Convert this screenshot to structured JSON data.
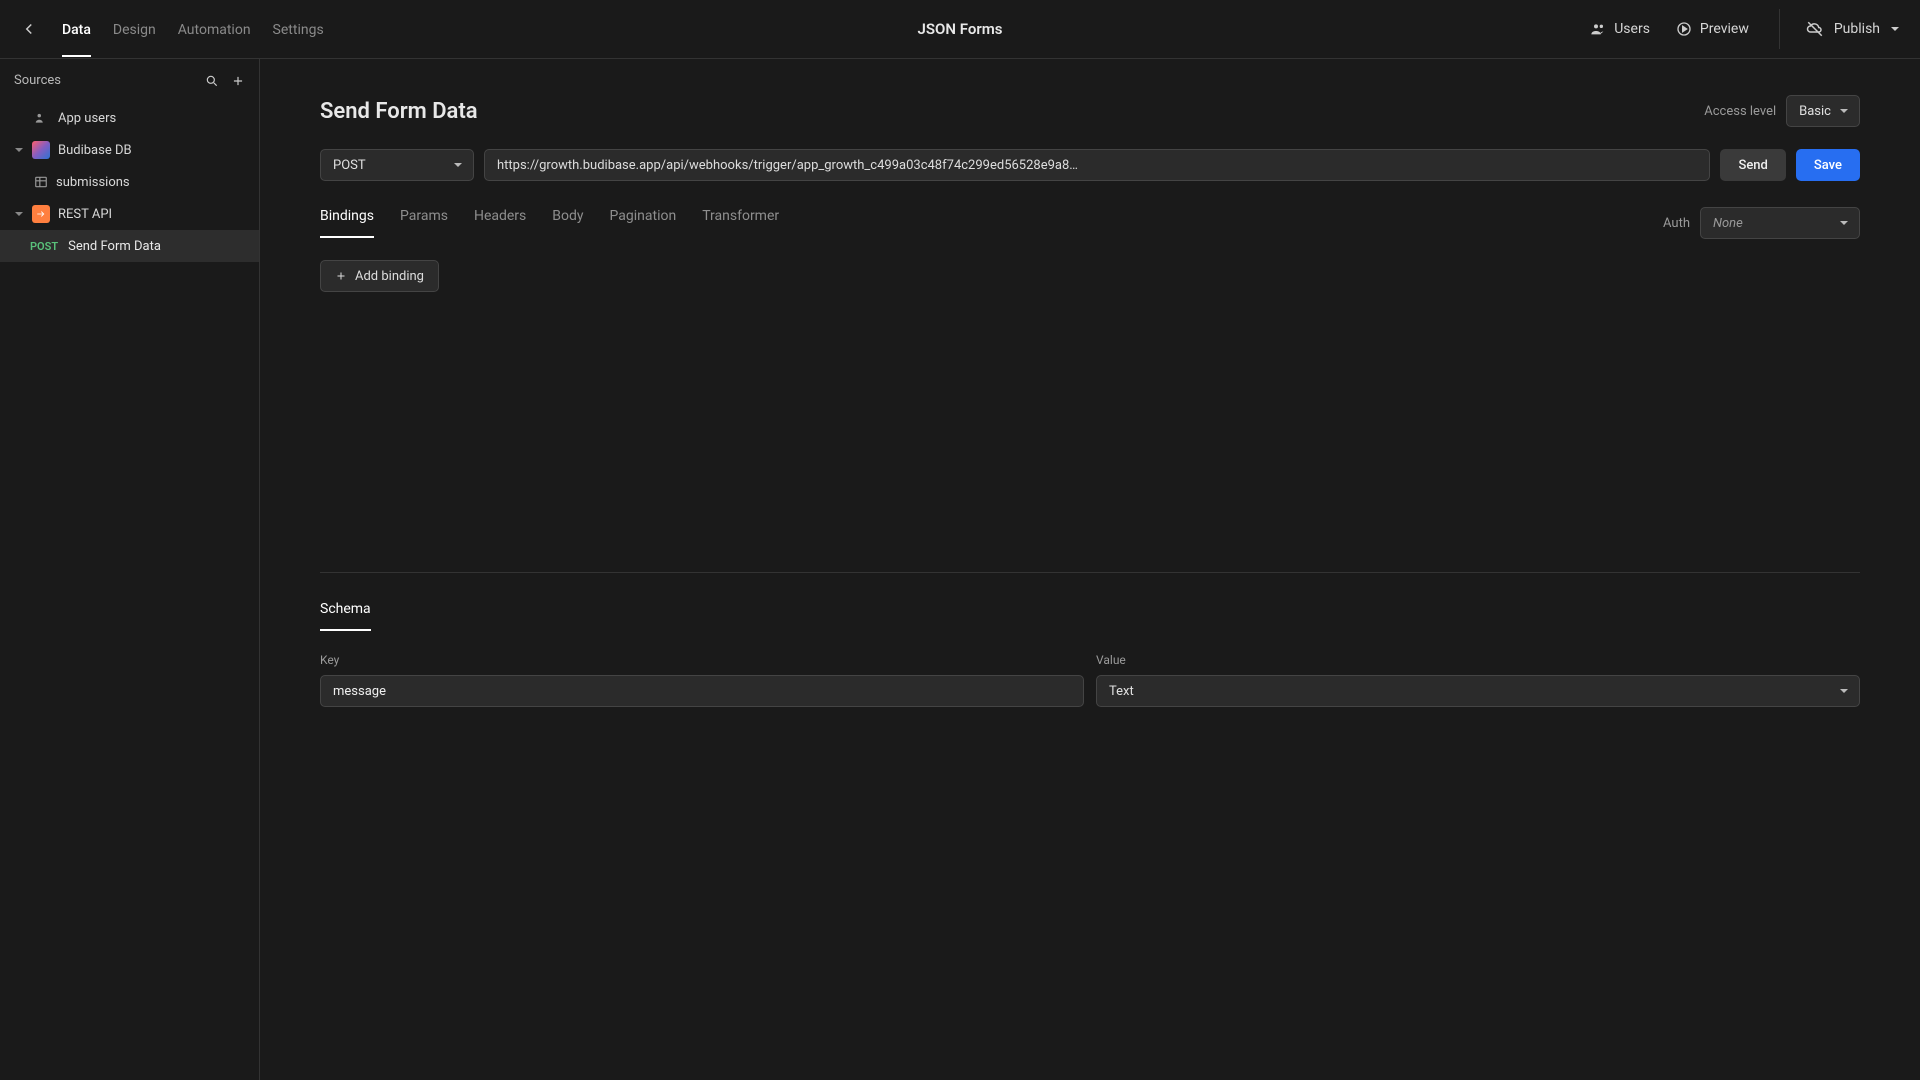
{
  "header": {
    "app_title": "JSON Forms",
    "tabs": {
      "data": "Data",
      "design": "Design",
      "automation": "Automation",
      "settings": "Settings"
    },
    "right": {
      "users": "Users",
      "preview": "Preview",
      "publish": "Publish"
    }
  },
  "sidebar": {
    "title": "Sources",
    "items": {
      "app_users": "App users",
      "budibase_db": "Budibase DB",
      "submissions": "submissions",
      "rest": "REST API",
      "query_method": "POST",
      "query_name": "Send Form Data"
    }
  },
  "page": {
    "title": "Send Form Data",
    "access_label": "Access level",
    "access_value": "Basic",
    "method": "POST",
    "url": "https://growth.budibase.app/api/webhooks/trigger/app_growth_c499a03c48f74c299ed56528e9a8…",
    "send": "Send",
    "save": "Save",
    "subtabs": {
      "bindings": "Bindings",
      "params": "Params",
      "headers": "Headers",
      "body": "Body",
      "pagination": "Pagination",
      "transformer": "Transformer"
    },
    "auth_label": "Auth",
    "auth_value": "None",
    "add_binding": "Add binding",
    "schema_tab": "Schema",
    "schema": {
      "key_label": "Key",
      "value_label": "Value",
      "key_value": "message",
      "value_type": "Text"
    }
  }
}
